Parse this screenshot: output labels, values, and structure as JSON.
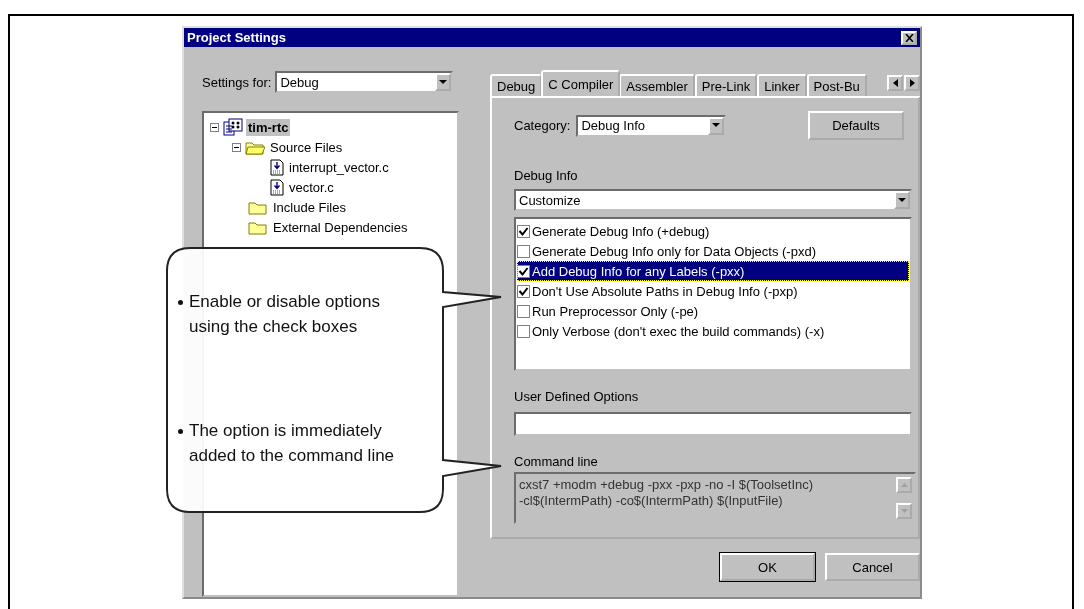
{
  "window": {
    "title": "Project Settings"
  },
  "settings_for": {
    "label": "Settings for:",
    "value": "Debug"
  },
  "tree": [
    {
      "label": "tim-rtc",
      "kind": "project",
      "expanded": true,
      "selected": true,
      "children": [
        {
          "label": "Source Files",
          "kind": "folder",
          "expanded": true,
          "selected": false,
          "children": [
            {
              "label": "interrupt_vector.c",
              "kind": "file",
              "selected": false
            },
            {
              "label": "vector.c",
              "kind": "file",
              "selected": false
            }
          ]
        },
        {
          "label": "Include Files",
          "kind": "folder",
          "selected": false
        },
        {
          "label": "External Dependencies",
          "kind": "folder",
          "selected": false
        }
      ]
    }
  ],
  "tabs": [
    {
      "label": "Debug",
      "selected": false
    },
    {
      "label": "C Compiler",
      "selected": true
    },
    {
      "label": "Assembler",
      "selected": false
    },
    {
      "label": "Pre-Link",
      "selected": false
    },
    {
      "label": "Linker",
      "selected": false
    },
    {
      "label": "Post-Bu",
      "selected": false
    }
  ],
  "category": {
    "label": "Category:",
    "value": "Debug Info"
  },
  "defaults_button": "Defaults",
  "debug_info": {
    "label": "Debug Info",
    "value": "Customize"
  },
  "options": [
    {
      "label": "Generate Debug Info (+debug)",
      "checked": true,
      "selected": false
    },
    {
      "label": "Generate Debug Info only for Data Objects (-pxd)",
      "checked": false,
      "selected": false
    },
    {
      "label": "Add Debug Info for any Labels (-pxx)",
      "checked": true,
      "selected": true
    },
    {
      "label": "Don't Use Absolute Paths in Debug Info (-pxp)",
      "checked": true,
      "selected": false
    },
    {
      "label": "Run Preprocessor Only (-pe)",
      "checked": false,
      "selected": false
    },
    {
      "label": "Only Verbose (don't exec the build commands) (-x)",
      "checked": false,
      "selected": false
    }
  ],
  "user_defined_options": {
    "label": "User Defined Options"
  },
  "command_line": {
    "label": "Command line",
    "lines": [
      "cxst7 +modm +debug -pxx -pxp -no -I $(ToolsetInc)",
      "-cl$(IntermPath) -co$(IntermPath) $(InputFile)"
    ]
  },
  "buttons": [
    "OK",
    "Cancel"
  ],
  "callout": [
    "Enable or disable options using the check boxes",
    "The option is immediately added to the command line"
  ]
}
